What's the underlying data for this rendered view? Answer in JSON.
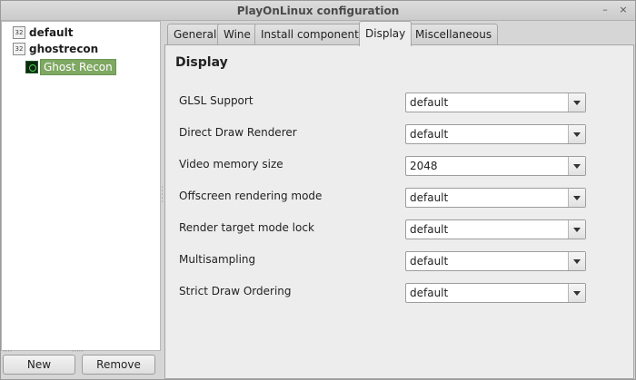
{
  "window": {
    "title": "PlayOnLinux configuration",
    "min_glyph": "–",
    "close_glyph": "×"
  },
  "tree": {
    "items": [
      {
        "label": "default",
        "icon": "32-bit-prefix-icon",
        "badge": "32"
      },
      {
        "label": "ghostrecon",
        "icon": "32-bit-prefix-icon",
        "badge": "32"
      }
    ],
    "selected_child": {
      "label": "Ghost Recon",
      "icon": "ghost-recon-game-icon"
    }
  },
  "buttons": {
    "new": "New",
    "remove": "Remove"
  },
  "tabs": [
    {
      "label": "General",
      "active": false
    },
    {
      "label": "Wine",
      "active": false
    },
    {
      "label": "Install components",
      "active": false
    },
    {
      "label": "Display",
      "active": true
    },
    {
      "label": "Miscellaneous",
      "active": false
    }
  ],
  "panel": {
    "heading": "Display",
    "settings": [
      {
        "label": "GLSL Support",
        "value": "default"
      },
      {
        "label": "Direct Draw Renderer",
        "value": "default"
      },
      {
        "label": "Video memory size",
        "value": "2048"
      },
      {
        "label": "Offscreen rendering mode",
        "value": "default"
      },
      {
        "label": "Render target mode lock",
        "value": "default"
      },
      {
        "label": "Multisampling",
        "value": "default"
      },
      {
        "label": "Strict Draw Ordering",
        "value": "default"
      }
    ]
  },
  "colors": {
    "selection": "#7fa862",
    "panel_bg": "#ededed",
    "window_bg": "#d6d6d6"
  }
}
